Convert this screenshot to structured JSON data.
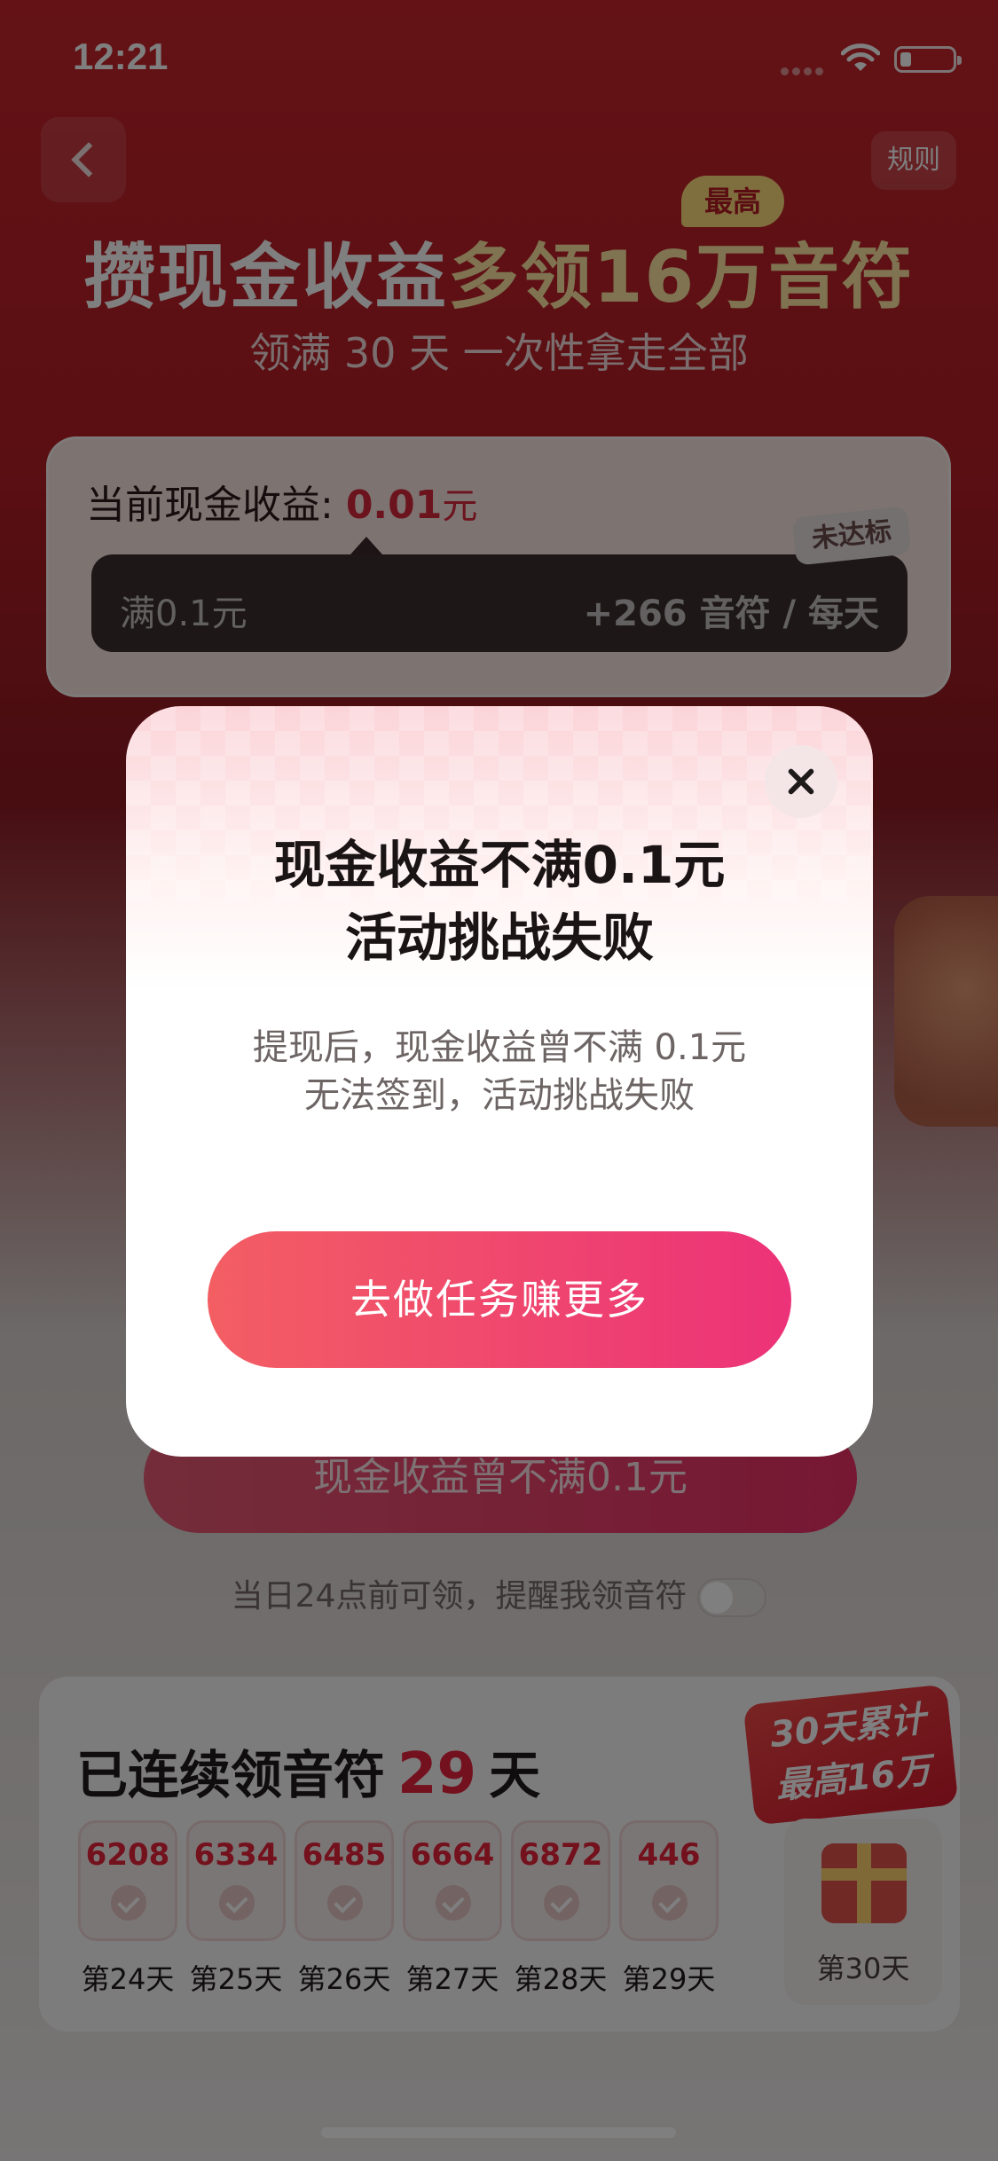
{
  "status_bar": {
    "time": "12:21"
  },
  "header": {
    "back_icon": "chevron-left-icon",
    "rules_label": "规则",
    "headline_main": "攒现金收益",
    "headline_highlight": "多领16万音符",
    "max_badge": "最高",
    "subhead": "领满 30 天  一次性拿走全部"
  },
  "earnings": {
    "label": "当前现金收益: ",
    "value": "0.01",
    "unit": "元",
    "progress_left": "满0.1元",
    "progress_right": "+266 音符 / 每天",
    "status_tag": "未达标"
  },
  "background_button": {
    "label": "现金收益曾不满0.1元"
  },
  "reminder": {
    "text": "当日24点前可领，提醒我领音符",
    "toggle_on": false
  },
  "streak": {
    "title_prefix": "已连续领音符",
    "days": "29",
    "title_suffix": "天",
    "total_badge_line1": "30天累计",
    "total_badge_line2": "最高16万",
    "tiles": [
      {
        "points": "6208",
        "label": "第24天"
      },
      {
        "points": "6334",
        "label": "第25天"
      },
      {
        "points": "6485",
        "label": "第26天"
      },
      {
        "points": "6664",
        "label": "第27天"
      },
      {
        "points": "6872",
        "label": "第28天"
      },
      {
        "points": "446",
        "label": "第29天"
      }
    ],
    "day30_label": "第30天"
  },
  "modal": {
    "title_line1": "现金收益不满0.1元",
    "title_line2": "活动挑战失败",
    "desc_line1": "提现后，现金收益曾不满 0.1元",
    "desc_line2": "无法签到，活动挑战失败",
    "cta_label": "去做任务赚更多",
    "close_icon": "close-icon"
  },
  "colors": {
    "brand_red": "#d8283a",
    "cta_gradient_start": "#f35e63",
    "cta_gradient_end": "#ec3278"
  }
}
